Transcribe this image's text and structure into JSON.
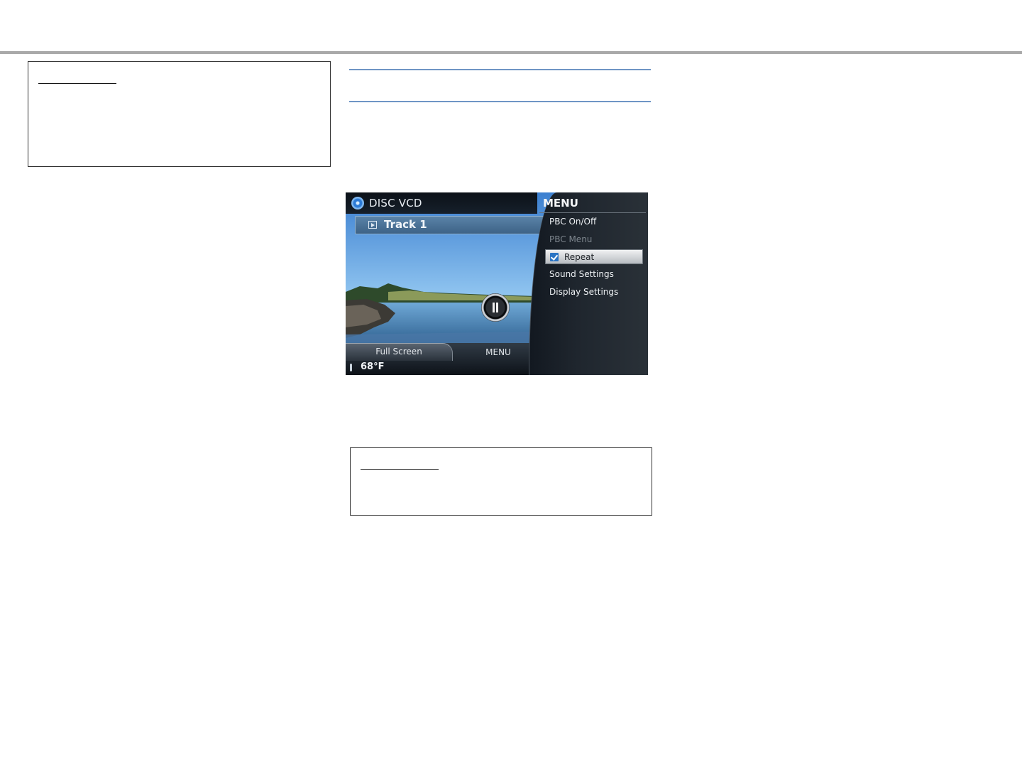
{
  "screen": {
    "header": {
      "title": "DISC VCD"
    },
    "track": {
      "label": "Track 1"
    },
    "controls": {
      "full_screen_label": "Full Screen",
      "menu_label": "MENU"
    },
    "status": {
      "temperature": "68°F"
    },
    "menu": {
      "title": "MENU",
      "items": [
        {
          "label": "PBC On/Off",
          "state": "enabled"
        },
        {
          "label": "PBC Menu",
          "state": "disabled"
        },
        {
          "label": "Repeat",
          "state": "selected",
          "checked": true
        },
        {
          "label": "Sound Settings",
          "state": "enabled"
        },
        {
          "label": "Display Settings",
          "state": "enabled"
        }
      ]
    }
  },
  "colors": {
    "top_rule": "#a9a9a9",
    "section_rule": "#6f95c5",
    "checkbox": "#2a74c4"
  }
}
